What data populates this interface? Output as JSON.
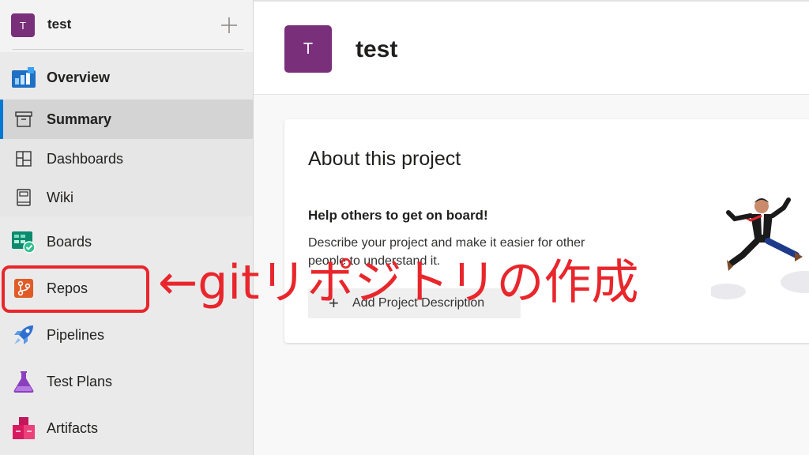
{
  "sidebar": {
    "project_initial": "T",
    "project_name": "test",
    "items": [
      {
        "label": "Overview"
      },
      {
        "label": "Summary"
      },
      {
        "label": "Dashboards"
      },
      {
        "label": "Wiki"
      },
      {
        "label": "Boards"
      },
      {
        "label": "Repos"
      },
      {
        "label": "Pipelines"
      },
      {
        "label": "Test Plans"
      },
      {
        "label": "Artifacts"
      }
    ]
  },
  "main": {
    "project_initial": "T",
    "project_name": "test",
    "about": {
      "title": "About this project",
      "subtitle": "Help others to get on board!",
      "description": "Describe your project and make it easier for other people to understand it.",
      "add_button": "Add Project Description"
    }
  },
  "annotation": {
    "text": "←gitリポジトリの作成",
    "color": "#e8262c"
  },
  "colors": {
    "avatar": "#7a2f7b",
    "accent": "#0078d4",
    "highlight": "#e8262c"
  }
}
